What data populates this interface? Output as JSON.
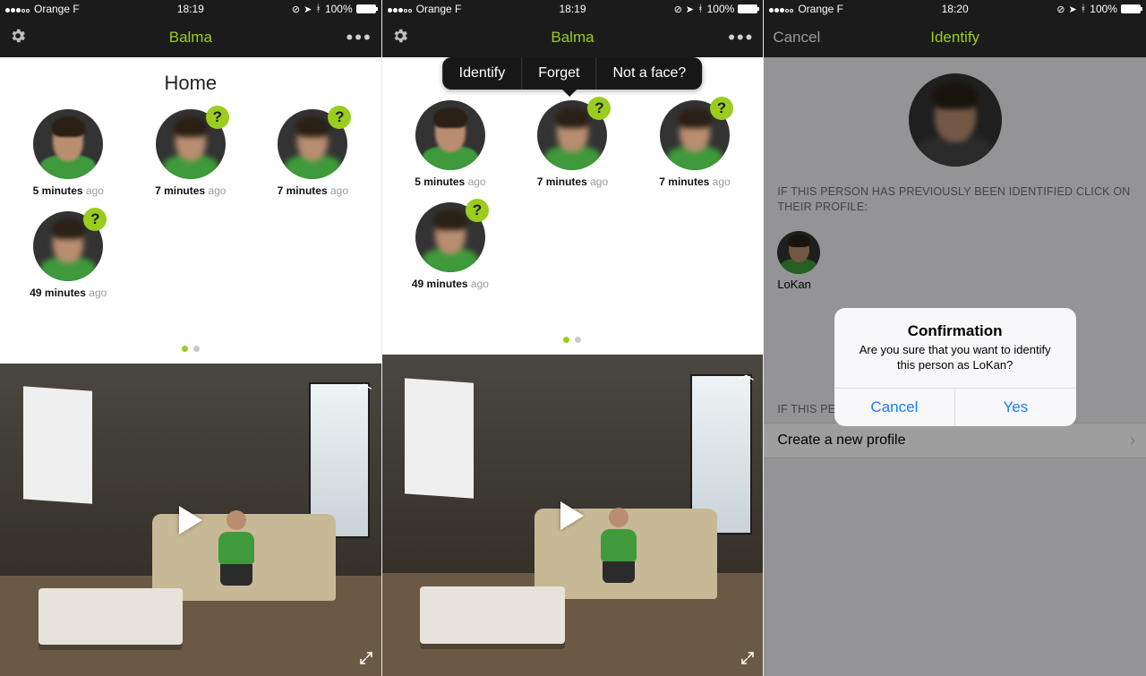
{
  "accent": "#9acd1e",
  "paneA": {
    "status": {
      "carrier": "Orange F",
      "time": "18:19",
      "battery": "100%"
    },
    "title": "Balma",
    "section": "Home",
    "faces": [
      {
        "time_value": "5 minutes",
        "time_suffix": "ago",
        "unknown": false
      },
      {
        "time_value": "7 minutes",
        "time_suffix": "ago",
        "unknown": true
      },
      {
        "time_value": "7 minutes",
        "time_suffix": "ago",
        "unknown": true
      },
      {
        "time_value": "49 minutes",
        "time_suffix": "ago",
        "unknown": true
      }
    ]
  },
  "paneB": {
    "status": {
      "carrier": "Orange F",
      "time": "18:19",
      "battery": "100%"
    },
    "title": "Balma",
    "popover": {
      "identify": "Identify",
      "forget": "Forget",
      "not_face": "Not a face?"
    },
    "faces": [
      {
        "time_value": "5 minutes",
        "time_suffix": "ago",
        "unknown": false
      },
      {
        "time_value": "7 minutes",
        "time_suffix": "ago",
        "unknown": true
      },
      {
        "time_value": "7 minutes",
        "time_suffix": "ago",
        "unknown": true
      },
      {
        "time_value": "49 minutes",
        "time_suffix": "ago",
        "unknown": true
      }
    ]
  },
  "paneC": {
    "status": {
      "carrier": "Orange F",
      "time": "18:20",
      "battery": "100%"
    },
    "cancel": "Cancel",
    "title": "Identify",
    "caption_existing": "IF THIS PERSON HAS PREVIOUSLY BEEN IDENTIFIED CLICK ON THEIR PROFILE:",
    "profile_name": "LoKan",
    "caption_new": "IF THIS PERSON HAS NOT YET BEEN IDENTIFIED:",
    "create": "Create a new profile",
    "alert": {
      "title": "Confirmation",
      "message": "Are you sure that you want to identify this person as LoKan?",
      "cancel": "Cancel",
      "yes": "Yes"
    }
  }
}
